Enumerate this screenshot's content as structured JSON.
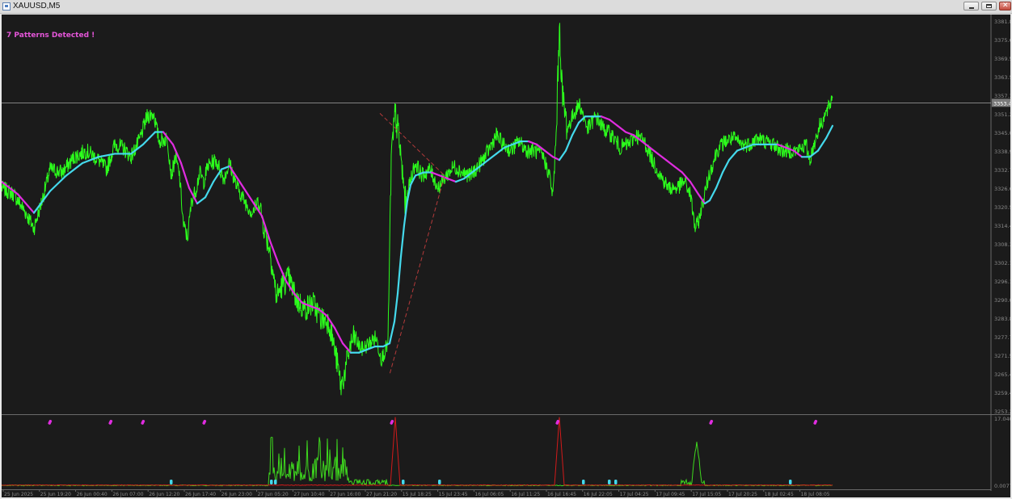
{
  "window": {
    "title": "XAUUSD,M5",
    "buttons": {
      "minimize": "minimize-icon",
      "maximize": "maximize-icon",
      "close": "close-icon"
    }
  },
  "chart": {
    "pattern_message": "7 Patterns Detected !",
    "price_axis_labels": [
      "3381.8",
      "3375.6",
      "3369.5",
      "3363.5",
      "3357.3",
      "3351.2",
      "3345.0",
      "3338.9",
      "3332.7",
      "3326.6",
      "3320.5",
      "3314.4",
      "3308.3",
      "3302.1",
      "3296.1",
      "3290.0",
      "3283.8",
      "3277.7",
      "3271.5",
      "3265.4",
      "3259.4",
      "3253.2"
    ],
    "current_price_label": "3353.4",
    "time_axis_labels": [
      "25 Jun 2025",
      "25 Jun 19:20",
      "26 Jun 00:40",
      "26 Jun 07:00",
      "26 Jun 12:20",
      "26 Jun 17:40",
      "26 Jun 23:00",
      "27 Jun 05:20",
      "27 Jun 10:40",
      "27 Jun 16:00",
      "27 Jun 21:20",
      "15 Jul 18:25",
      "15 Jul 23:45",
      "16 Jul 06:05",
      "16 Jul 11:25",
      "16 Jul 16:45",
      "16 Jul 22:05",
      "17 Jul 04:25",
      "17 Jul 09:45",
      "17 Jul 15:05",
      "17 Jul 20:25",
      "18 Jul 02:45",
      "18 Jul 08:05"
    ],
    "sub_axis_labels": {
      "top": "17.040",
      "bottom": "0.0077"
    },
    "colors": {
      "background": "#1b1b1b",
      "price": "#2cff1c",
      "ma_down": "#e02ce0",
      "ma_up": "#44d9ec",
      "trend": "#b33a3a",
      "indicator_red": "#d21a1a",
      "indicator_green": "#3ed81e",
      "axis_text": "#8a8a8a"
    }
  },
  "chart_data": {
    "type": "line",
    "symbol": "XAUUSD",
    "timeframe": "M5",
    "ylim": [
      3253.2,
      3381.8
    ],
    "close_path": [
      [
        0,
        3326
      ],
      [
        15,
        3324
      ],
      [
        30,
        3318
      ],
      [
        40,
        3313
      ],
      [
        50,
        3322
      ],
      [
        60,
        3332
      ],
      [
        75,
        3331
      ],
      [
        90,
        3336
      ],
      [
        105,
        3338
      ],
      [
        120,
        3335
      ],
      [
        130,
        3332
      ],
      [
        140,
        3340
      ],
      [
        150,
        3339
      ],
      [
        160,
        3336
      ],
      [
        170,
        3341
      ],
      [
        180,
        3349
      ],
      [
        188,
        3350
      ],
      [
        195,
        3341
      ],
      [
        205,
        3342
      ],
      [
        210,
        3330
      ],
      [
        215,
        3336
      ],
      [
        220,
        3330
      ],
      [
        225,
        3314
      ],
      [
        230,
        3310
      ],
      [
        235,
        3322
      ],
      [
        240,
        3325
      ],
      [
        245,
        3331
      ],
      [
        250,
        3328
      ],
      [
        255,
        3333
      ],
      [
        265,
        3335
      ],
      [
        275,
        3329
      ],
      [
        282,
        3334
      ],
      [
        290,
        3327
      ],
      [
        300,
        3322
      ],
      [
        310,
        3318
      ],
      [
        318,
        3322
      ],
      [
        325,
        3313
      ],
      [
        332,
        3306
      ],
      [
        340,
        3291
      ],
      [
        348,
        3295
      ],
      [
        355,
        3297
      ],
      [
        365,
        3290
      ],
      [
        375,
        3287
      ],
      [
        385,
        3289
      ],
      [
        395,
        3284
      ],
      [
        405,
        3283
      ],
      [
        415,
        3270
      ],
      [
        420,
        3262
      ],
      [
        426,
        3268
      ],
      [
        430,
        3274
      ],
      [
        436,
        3278
      ],
      [
        445,
        3274
      ],
      [
        455,
        3276
      ],
      [
        463,
        3278
      ],
      [
        470,
        3271
      ],
      [
        478,
        3276
      ],
      [
        482,
        3335
      ],
      [
        487,
        3350
      ],
      [
        492,
        3341
      ],
      [
        496,
        3330
      ],
      [
        500,
        3320
      ],
      [
        505,
        3328
      ],
      [
        512,
        3334
      ],
      [
        520,
        3330
      ],
      [
        530,
        3332
      ],
      [
        540,
        3326
      ],
      [
        550,
        3330
      ],
      [
        560,
        3333
      ],
      [
        570,
        3331
      ],
      [
        580,
        3330
      ],
      [
        590,
        3333
      ],
      [
        600,
        3337
      ],
      [
        612,
        3343
      ],
      [
        620,
        3340
      ],
      [
        630,
        3338
      ],
      [
        640,
        3341
      ],
      [
        650,
        3338
      ],
      [
        660,
        3338
      ],
      [
        670,
        3336
      ],
      [
        678,
        3330
      ],
      [
        682,
        3323
      ],
      [
        686,
        3342
      ],
      [
        690,
        3378
      ],
      [
        694,
        3355
      ],
      [
        700,
        3345
      ],
      [
        708,
        3350
      ],
      [
        715,
        3353
      ],
      [
        725,
        3345
      ],
      [
        735,
        3349
      ],
      [
        745,
        3345
      ],
      [
        755,
        3343
      ],
      [
        765,
        3339
      ],
      [
        775,
        3340
      ],
      [
        785,
        3343
      ],
      [
        795,
        3341
      ],
      [
        805,
        3335
      ],
      [
        815,
        3330
      ],
      [
        825,
        3326
      ],
      [
        835,
        3326
      ],
      [
        845,
        3328
      ],
      [
        852,
        3324
      ],
      [
        858,
        3313
      ],
      [
        862,
        3315
      ],
      [
        868,
        3322
      ],
      [
        875,
        3330
      ],
      [
        885,
        3338
      ],
      [
        895,
        3341
      ],
      [
        905,
        3342
      ],
      [
        915,
        3340
      ],
      [
        925,
        3340
      ],
      [
        935,
        3342
      ],
      [
        945,
        3341
      ],
      [
        955,
        3340
      ],
      [
        965,
        3338
      ],
      [
        975,
        3338
      ],
      [
        985,
        3338
      ],
      [
        995,
        3340
      ],
      [
        1000,
        3335
      ],
      [
        1005,
        3340
      ],
      [
        1012,
        3346
      ],
      [
        1018,
        3349
      ],
      [
        1024,
        3352
      ],
      [
        1028,
        3356
      ]
    ],
    "moving_average": [
      [
        0,
        3328
      ],
      [
        20,
        3324
      ],
      [
        40,
        3318
      ],
      [
        60,
        3325
      ],
      [
        80,
        3330
      ],
      [
        100,
        3334
      ],
      [
        120,
        3336
      ],
      [
        140,
        3337
      ],
      [
        160,
        3337
      ],
      [
        175,
        3340
      ],
      [
        190,
        3344
      ],
      [
        200,
        3344
      ],
      [
        212,
        3340
      ],
      [
        222,
        3334
      ],
      [
        232,
        3326
      ],
      [
        242,
        3321
      ],
      [
        252,
        3323
      ],
      [
        262,
        3328
      ],
      [
        272,
        3332
      ],
      [
        282,
        3333
      ],
      [
        292,
        3329
      ],
      [
        302,
        3325
      ],
      [
        312,
        3321
      ],
      [
        322,
        3317
      ],
      [
        332,
        3309
      ],
      [
        342,
        3302
      ],
      [
        352,
        3296
      ],
      [
        362,
        3292
      ],
      [
        372,
        3289
      ],
      [
        382,
        3288
      ],
      [
        392,
        3287
      ],
      [
        402,
        3285
      ],
      [
        412,
        3281
      ],
      [
        422,
        3276
      ],
      [
        432,
        3273
      ],
      [
        442,
        3273
      ],
      [
        452,
        3274
      ],
      [
        462,
        3275
      ],
      [
        472,
        3275
      ],
      [
        480,
        3276
      ],
      [
        486,
        3283
      ],
      [
        490,
        3292
      ],
      [
        494,
        3304
      ],
      [
        498,
        3314
      ],
      [
        502,
        3322
      ],
      [
        506,
        3327
      ],
      [
        512,
        3330
      ],
      [
        522,
        3331
      ],
      [
        532,
        3331
      ],
      [
        542,
        3330
      ],
      [
        552,
        3329
      ],
      [
        562,
        3328
      ],
      [
        572,
        3329
      ],
      [
        582,
        3331
      ],
      [
        592,
        3333
      ],
      [
        602,
        3335
      ],
      [
        612,
        3337
      ],
      [
        622,
        3339
      ],
      [
        632,
        3340
      ],
      [
        642,
        3341
      ],
      [
        652,
        3341
      ],
      [
        662,
        3340
      ],
      [
        672,
        3338
      ],
      [
        682,
        3336
      ],
      [
        690,
        3335
      ],
      [
        698,
        3338
      ],
      [
        706,
        3343
      ],
      [
        714,
        3347
      ],
      [
        722,
        3349
      ],
      [
        732,
        3349
      ],
      [
        742,
        3349
      ],
      [
        752,
        3348
      ],
      [
        762,
        3346
      ],
      [
        772,
        3344
      ],
      [
        782,
        3343
      ],
      [
        792,
        3341
      ],
      [
        802,
        3339
      ],
      [
        812,
        3337
      ],
      [
        822,
        3335
      ],
      [
        832,
        3333
      ],
      [
        842,
        3331
      ],
      [
        852,
        3328
      ],
      [
        862,
        3324
      ],
      [
        870,
        3321
      ],
      [
        876,
        3322
      ],
      [
        884,
        3326
      ],
      [
        892,
        3331
      ],
      [
        900,
        3335
      ],
      [
        910,
        3338
      ],
      [
        920,
        3339
      ],
      [
        930,
        3340
      ],
      [
        940,
        3340
      ],
      [
        950,
        3340
      ],
      [
        960,
        3340
      ],
      [
        970,
        3339
      ],
      [
        980,
        3338
      ],
      [
        990,
        3336
      ],
      [
        1000,
        3336
      ],
      [
        1010,
        3338
      ],
      [
        1020,
        3342
      ],
      [
        1028,
        3346
      ]
    ],
    "trend_line": [
      [
        468,
        3350
      ],
      [
        548,
        3330
      ],
      [
        480,
        3266
      ]
    ],
    "subwindow": {
      "ylim": [
        0.0077,
        17.04
      ],
      "red_spikes_x": [
        487,
        690
      ],
      "green_activity_x": [
        330,
        430
      ],
      "green_spike_x": 860,
      "magenta_markers_x": [
        60,
        135,
        175,
        251,
        483,
        688,
        878,
        1007
      ],
      "cyan_markers_x": [
        210,
        334,
        339,
        497,
        542,
        720,
        752,
        760,
        976
      ]
    }
  }
}
